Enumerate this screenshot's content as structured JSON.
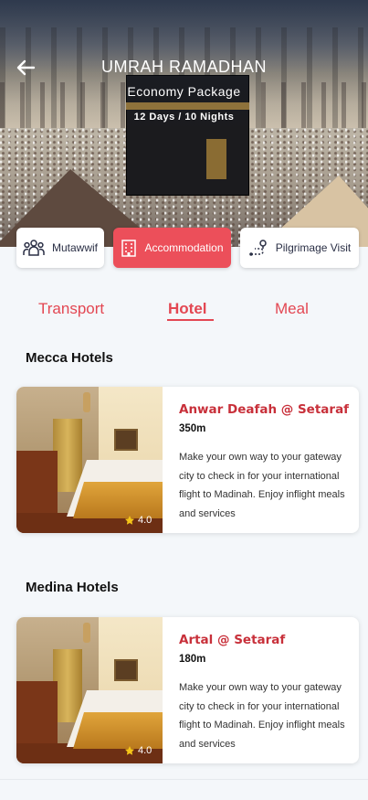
{
  "header": {
    "title": "UMRAH RAMADHAN",
    "subtitle": "Economy Package",
    "duration": "12 Days / 10 Nights"
  },
  "categories": [
    {
      "label": "Mutawwif",
      "icon": "group-icon"
    },
    {
      "label": "Accommodation",
      "icon": "building-icon",
      "active": true
    },
    {
      "label": "Pilgrimage Visit",
      "icon": "route-icon"
    }
  ],
  "subtabs": [
    {
      "label": "Transport"
    },
    {
      "label": "Hotel",
      "active": true
    },
    {
      "label": "Meal"
    }
  ],
  "sections": [
    {
      "title": "Mecca Hotels",
      "hotel": {
        "name": "Anwar Deafah @ Setaraf",
        "distance": "350m",
        "description": "Make your own way to your gateway city to check in for your international flight to Madinah. Enjoy inflight meals and services",
        "rating": "4.0"
      }
    },
    {
      "title": "Medina Hotels",
      "hotel": {
        "name": "Artal @ Setaraf",
        "distance": "180m",
        "description": "Make your own way to your gateway city to check in for your international flight to Madinah. Enjoy inflight meals and services",
        "rating": "4.0"
      }
    }
  ],
  "colors": {
    "accent": "#ec4f5a",
    "hotel_name": "#c8303a",
    "star": "#f5c518"
  }
}
